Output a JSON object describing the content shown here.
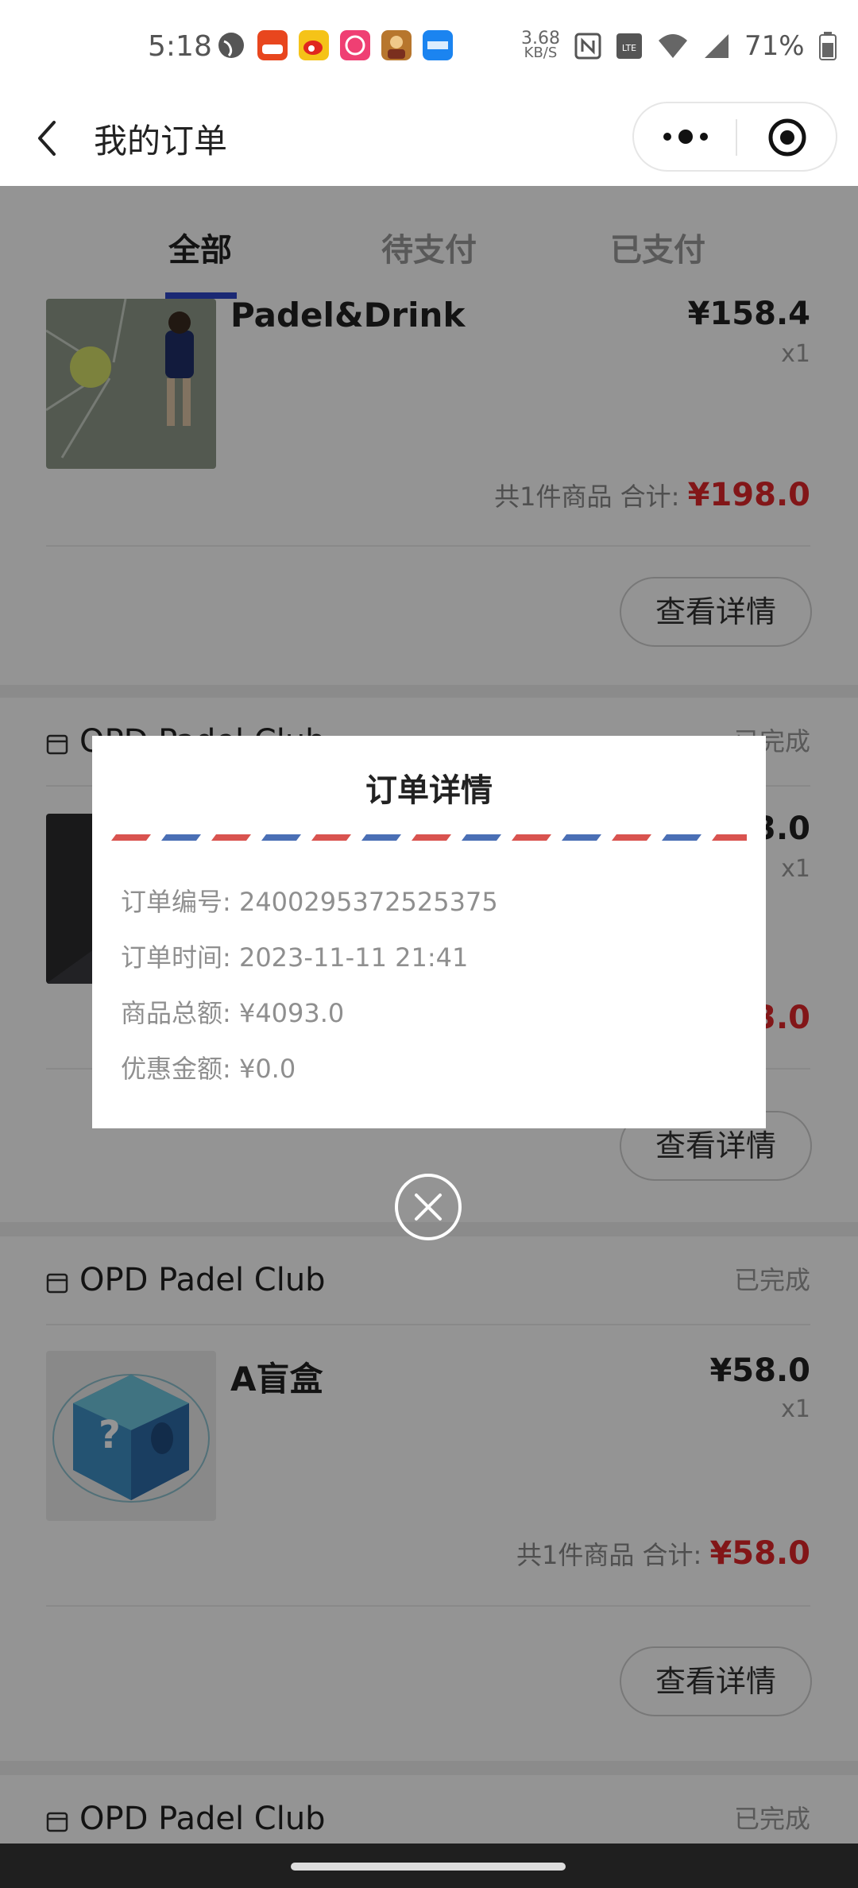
{
  "status_bar": {
    "time": "5:18",
    "net_speed_value": "3.68",
    "net_speed_unit": "KB/S",
    "battery_percent": "71%",
    "icons": [
      "globe-icon",
      "app-orange-icon",
      "weibo-icon",
      "app-pink-icon",
      "game-avatar-icon",
      "app-blue-icon",
      "nfc-icon",
      "volte-icon",
      "wifi-icon",
      "signal-icon",
      "battery-icon"
    ]
  },
  "title_bar": {
    "title": "我的订单"
  },
  "tabs": [
    {
      "label": "全部",
      "active": true
    },
    {
      "label": "待支付",
      "active": false
    },
    {
      "label": "已支付",
      "active": false
    }
  ],
  "orders": [
    {
      "shop": "",
      "status": "",
      "product": "Padel&Drink",
      "price": "¥158.4",
      "qty": "x1",
      "summary_label": "共1件商品 合计:",
      "summary_total": "¥198.0",
      "button": "查看详情"
    },
    {
      "shop": "OPD Padel Club",
      "status": "已完成",
      "product": "",
      "price": "3.0",
      "qty": "x1",
      "summary_label": "",
      "summary_total": "3.0",
      "button": "查看详情"
    },
    {
      "shop": "OPD Padel Club",
      "status": "已完成",
      "product": "A盲盒",
      "price": "¥58.0",
      "qty": "x1",
      "summary_label": "共1件商品 合计:",
      "summary_total": "¥58.0",
      "button": "查看详情"
    },
    {
      "shop": "OPD Padel Club",
      "status": "已完成"
    }
  ],
  "modal": {
    "title": "订单详情",
    "lines": [
      "订单编号: 2400295372525375",
      "订单时间: 2023-11-11 21:41",
      "商品总额: ¥4093.0",
      "优惠金额: ¥0.0"
    ]
  },
  "colors": {
    "accent_blue": "#2f47c8",
    "price_red": "#e1262a",
    "airmail_red": "#d9534f",
    "airmail_blue": "#4a6fb5"
  }
}
